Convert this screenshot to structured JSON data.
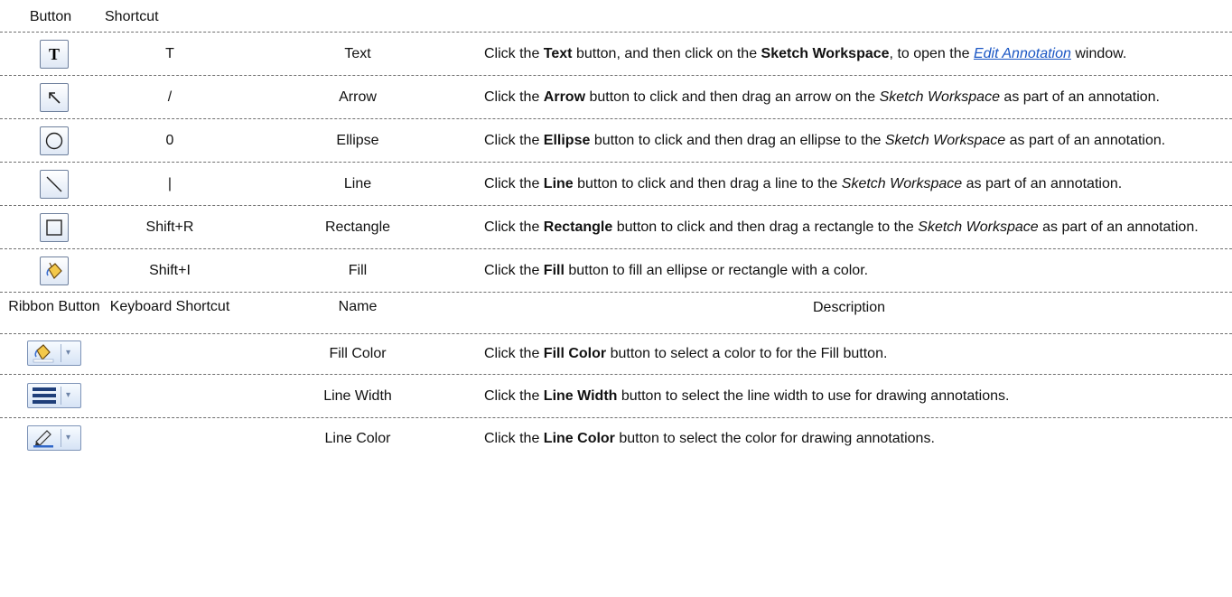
{
  "header1": {
    "col_button": "Button",
    "col_shortcut": "Shortcut"
  },
  "rows": [
    {
      "icon": "text-icon",
      "shortcut": "T",
      "name": "Text",
      "desc": {
        "a": "Click the ",
        "b1": "Text",
        "c": " button, and then click on the ",
        "b2": "Sketch Workspace",
        "d": ", to open the ",
        "link": "Edit Annotation",
        "e": " window."
      }
    },
    {
      "icon": "arrow-icon",
      "shortcut": "/",
      "name": "Arrow",
      "desc": {
        "a": "Click the ",
        "b1": "Arrow",
        "c": " button to click and then drag an arrow on the ",
        "i1": "Sketch Workspace",
        "d": " as part of an annotation."
      }
    },
    {
      "icon": "ellipse-icon",
      "shortcut": "0",
      "name": "Ellipse",
      "desc": {
        "a": "Click the ",
        "b1": "Ellipse",
        "c": " button to click and then drag an ellipse to the ",
        "i1": "Sketch Workspace",
        "d": " as part of an annotation."
      }
    },
    {
      "icon": "line-icon",
      "shortcut": "|",
      "name": "Line",
      "desc": {
        "a": "Click the ",
        "b1": "Line",
        "c": " button to click and then drag a line to the ",
        "i1": "Sketch Workspace",
        "d": " as part of an annotation."
      }
    },
    {
      "icon": "rectangle-icon",
      "shortcut": "Shift+R",
      "name": "Rectangle",
      "desc": {
        "a": "Click the ",
        "b1": "Rectangle",
        "c": " button to click and then drag a rectangle to the ",
        "i1": "Sketch Workspace",
        "d": " as part of an annotation."
      }
    },
    {
      "icon": "fill-bucket-icon",
      "shortcut": "Shift+I",
      "name": "Fill",
      "desc": {
        "a": "Click the ",
        "b1": "Fill",
        "c": " button to fill an ellipse or rectangle with a color."
      }
    }
  ],
  "header2": {
    "col_ribbon": "Ribbon Button",
    "col_keyboard": "Keyboard Shortcut",
    "col_name": "Name",
    "col_desc": "Description"
  },
  "ribbon_rows": [
    {
      "icon": "fill-color-dropdown-icon",
      "name": "Fill Color",
      "desc": {
        "a": "Click the ",
        "b1": "Fill Color",
        "c": " button to select a color to for the Fill button."
      }
    },
    {
      "icon": "line-width-dropdown-icon",
      "name": "Line Width",
      "desc": {
        "a": "Click the ",
        "b1": "Line Width",
        "c": " button to select the line width to use for drawing annotations."
      }
    },
    {
      "icon": "line-color-dropdown-icon",
      "name": "Line Color",
      "desc": {
        "a": "Click the ",
        "b1": "Line Color",
        "c": " button to select the color for drawing annotations."
      }
    }
  ],
  "colors": {
    "link": "#1a56c4",
    "rule": "#6f6f6f",
    "button_border": "#6d7f9c"
  }
}
